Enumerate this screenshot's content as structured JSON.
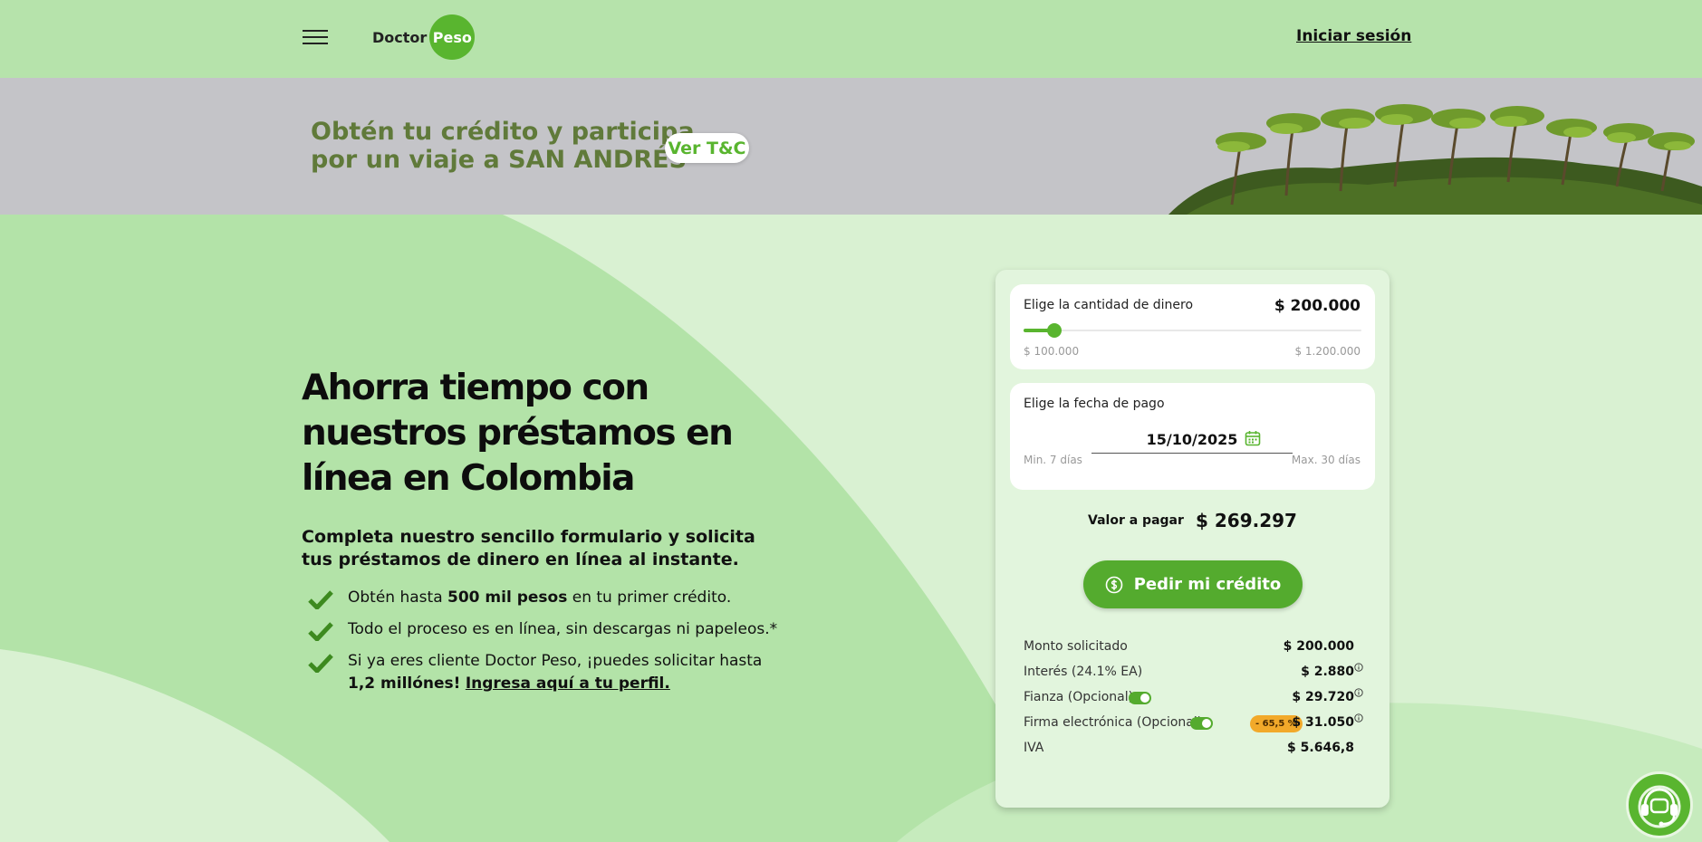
{
  "header": {
    "logo_left": "Doctor",
    "logo_right": "Peso",
    "login_label": "Iniciar sesión"
  },
  "promo": {
    "line1": "Obtén tu crédito y participa",
    "line2": "por un viaje a SAN ANDRÉS",
    "button_label": "Ver T&C"
  },
  "hero": {
    "title_line1": "Ahorra tiempo con",
    "title_line2": "nuestros préstamos en",
    "title_line3": "línea en Colombia",
    "subtitle": "Completa nuestro sencillo formulario y solicita tus préstamos de dinero en línea al instante.",
    "bullets": [
      {
        "pre": "Obtén hasta ",
        "bold": "500 mil pesos",
        "post": " en tu primer crédito."
      },
      {
        "text": "Todo el proceso es en línea, sin descargas ni papeleos.*"
      },
      {
        "pre": "Si ya eres cliente Doctor Peso, ¡puedes solicitar hasta ",
        "bold": "1,2 millónes!",
        "link": "Ingresa aquí a tu perfil."
      }
    ]
  },
  "calculator": {
    "amount_label": "Elige la cantidad de dinero",
    "amount_value": "$ 200.000",
    "amount_min": "$ 100.000",
    "amount_max": "$ 1.200.000",
    "amount_fraction": 0.0909,
    "date_label": "Elige la fecha de pago",
    "date_value": "15/10/2025",
    "date_min": "Min. 7 días",
    "date_max": "Max. 30 días",
    "total_label": "Valor a pagar",
    "total_value": "$ 269.297",
    "cta_label": "Pedir mi crédito",
    "breakdown": {
      "monto_label": "Monto solicitado",
      "monto_value": "$ 200.000",
      "interes_label": "Interés (24.1% EA)",
      "interes_value": "$ 2.880",
      "fianza_label": "Fianza (Opcional)",
      "fianza_value": "$ 29.720",
      "fianza_on": true,
      "firma_label": "Firma electrónica (Opcional)",
      "firma_value": "$ 31.050",
      "firma_on": true,
      "firma_discount": "- 65,5 %",
      "iva_label": "IVA",
      "iva_value": "$ 5.646,8"
    }
  },
  "colors": {
    "brand_green": "#59b52f",
    "header_bg": "#b6e3ab",
    "banner_bg": "#c4c4c8",
    "discount_badge": "#f2a92a"
  },
  "icons": [
    "menu-icon",
    "calendar-icon",
    "dollar-coin-icon",
    "check-icon",
    "info-icon",
    "headset-support-icon"
  ]
}
